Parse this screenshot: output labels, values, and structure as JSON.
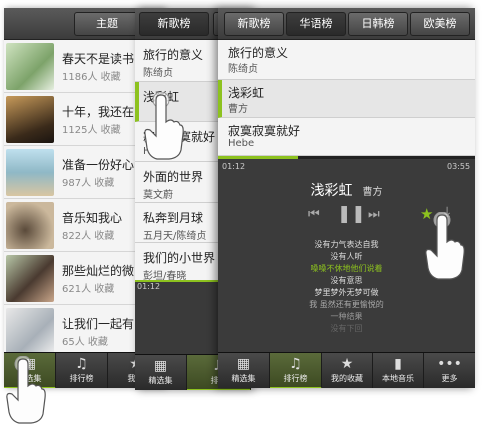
{
  "screen1": {
    "tabs": [
      "主题"
    ],
    "items": [
      {
        "title": "春天不是读书",
        "count": "1186人 收藏"
      },
      {
        "title": "十年，我还在",
        "count": "1125人 收藏"
      },
      {
        "title": "准备一份好心",
        "count": "987人 收藏"
      },
      {
        "title": "音乐知我心",
        "count": "822人 收藏"
      },
      {
        "title": "那些灿烂的微",
        "count": "621人 收藏"
      },
      {
        "title": "让我们一起有",
        "count": "65人 收藏"
      }
    ],
    "nav": [
      "精选集",
      "排行榜",
      "我的"
    ]
  },
  "screen2": {
    "tabs": [
      "新歌榜"
    ],
    "songs": [
      {
        "title": "旅行的意义",
        "artist": "陈绮贞"
      },
      {
        "title": "浅彩虹",
        "artist": ""
      },
      {
        "title": "寂寞寂寞就好",
        "artist": "Hebe"
      },
      {
        "title": "外面的世界",
        "artist": "莫文蔚"
      },
      {
        "title": "私奔到月球",
        "artist": "五月天/陈绮贞"
      },
      {
        "title": "我们的小世界",
        "artist": "彭坦/春晓"
      }
    ],
    "time": "01:12",
    "nav": [
      "精选集",
      "排行"
    ]
  },
  "screen3": {
    "tabs": [
      "新歌榜",
      "华语榜",
      "日韩榜",
      "欧美榜"
    ],
    "songs": [
      {
        "title": "旅行的意义",
        "artist": "陈绮贞"
      },
      {
        "title": "浅彩虹",
        "artist": "曹方"
      },
      {
        "title": "寂寞寂寞就好",
        "artist": "Hebe"
      }
    ],
    "player": {
      "elapsed": "01:12",
      "total": "03:55",
      "progress": 0.31,
      "title": "浅彩虹",
      "artist": "曹方",
      "lyrics": [
        "没有力气表达自我",
        "没有人听",
        "嗓嗓不休地他们说着",
        "没有意思",
        "梦里梦外无梦可做",
        "我 虽然还有更愉悦的",
        "一种结果",
        "没有下回"
      ],
      "highlight_index": 2
    },
    "nav": [
      "精选集",
      "排行榜",
      "我的收藏",
      "本地音乐",
      "更多"
    ]
  },
  "colors": {
    "accent": "#8dc21f"
  }
}
